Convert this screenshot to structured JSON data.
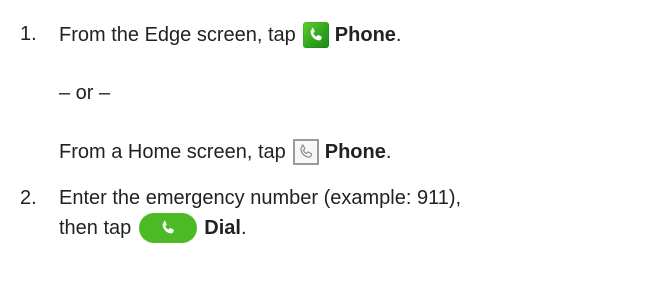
{
  "steps": [
    {
      "number": "1.",
      "line1": {
        "text_before": "From the Edge screen, tap",
        "icon": "phone-edge-icon",
        "label": "Phone",
        "text_after": "."
      },
      "alt_separator": "– or –",
      "alt_line": {
        "text_before": "From a Home screen, tap",
        "icon": "phone-home-icon",
        "label": "Phone",
        "text_after": "."
      }
    },
    {
      "number": "2.",
      "line1": "Enter the emergency number (example: 911),",
      "line2": {
        "text_before": "then tap",
        "icon": "dial-button-icon",
        "label": "Dial",
        "text_after": "."
      }
    }
  ],
  "colors": {
    "text": "#222222",
    "edge_icon_green": "#3fb526",
    "dial_green": "#4cba25",
    "home_icon_border": "#9a9a9a"
  }
}
